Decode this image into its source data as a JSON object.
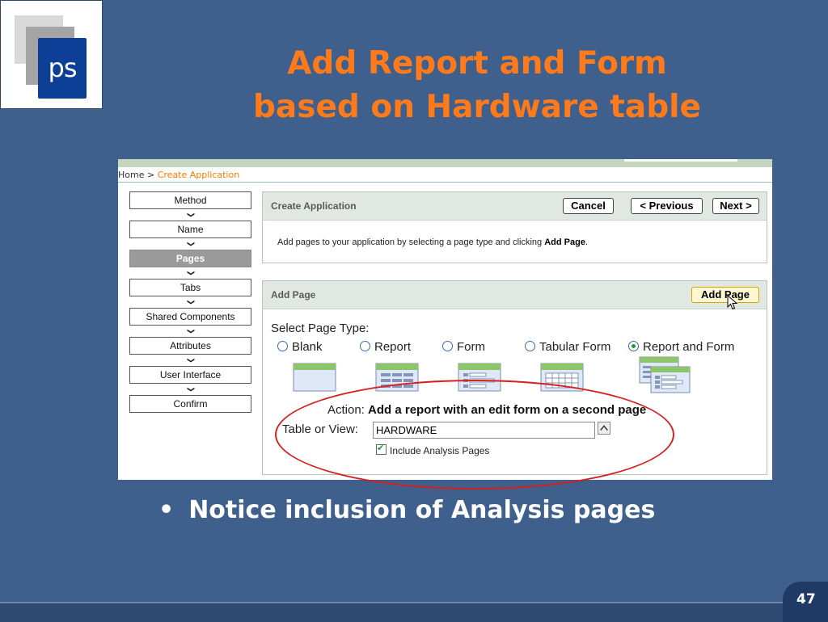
{
  "slide": {
    "logo_text": "ps",
    "title_line1": "Add Report and Form",
    "title_line2": "based on Hardware table",
    "bullet": "Notice inclusion of Analysis pages",
    "page_number": "47"
  },
  "app": {
    "breadcrumb": {
      "home": "Home",
      "separator": ">",
      "current": "Create Application"
    },
    "steps": [
      {
        "label": "Method",
        "active": false
      },
      {
        "label": "Name",
        "active": false
      },
      {
        "label": "Pages",
        "active": true
      },
      {
        "label": "Tabs",
        "active": false
      },
      {
        "label": "Shared Components",
        "active": false
      },
      {
        "label": "Attributes",
        "active": false
      },
      {
        "label": "User Interface",
        "active": false
      },
      {
        "label": "Confirm",
        "active": false
      }
    ],
    "create_region": {
      "title": "Create Application",
      "cancel": "Cancel",
      "previous": "< Previous",
      "next": "Next >",
      "intro_prefix": "Add pages to your application by selecting a page type and clicking ",
      "intro_bold": "Add Page",
      "intro_suffix": "."
    },
    "add_page_region": {
      "title": "Add Page",
      "add_button": "Add Page",
      "select_label": "Select Page Type:",
      "options": [
        "Blank",
        "Report",
        "Form",
        "Tabular Form",
        "Report and Form"
      ],
      "selected": "Report and Form",
      "action_label": "Action:",
      "action_value": "Add a report with an edit form on a second page",
      "table_label": "Table or View:",
      "table_value": "HARDWARE",
      "checkbox_label": "Include Analysis Pages",
      "checkbox_checked": true
    }
  },
  "colors": {
    "background": "#3f5f8c",
    "title": "#ff7a1a",
    "highlight_ellipse": "#d52020",
    "breadcrumb_link": "#ff7a00"
  }
}
